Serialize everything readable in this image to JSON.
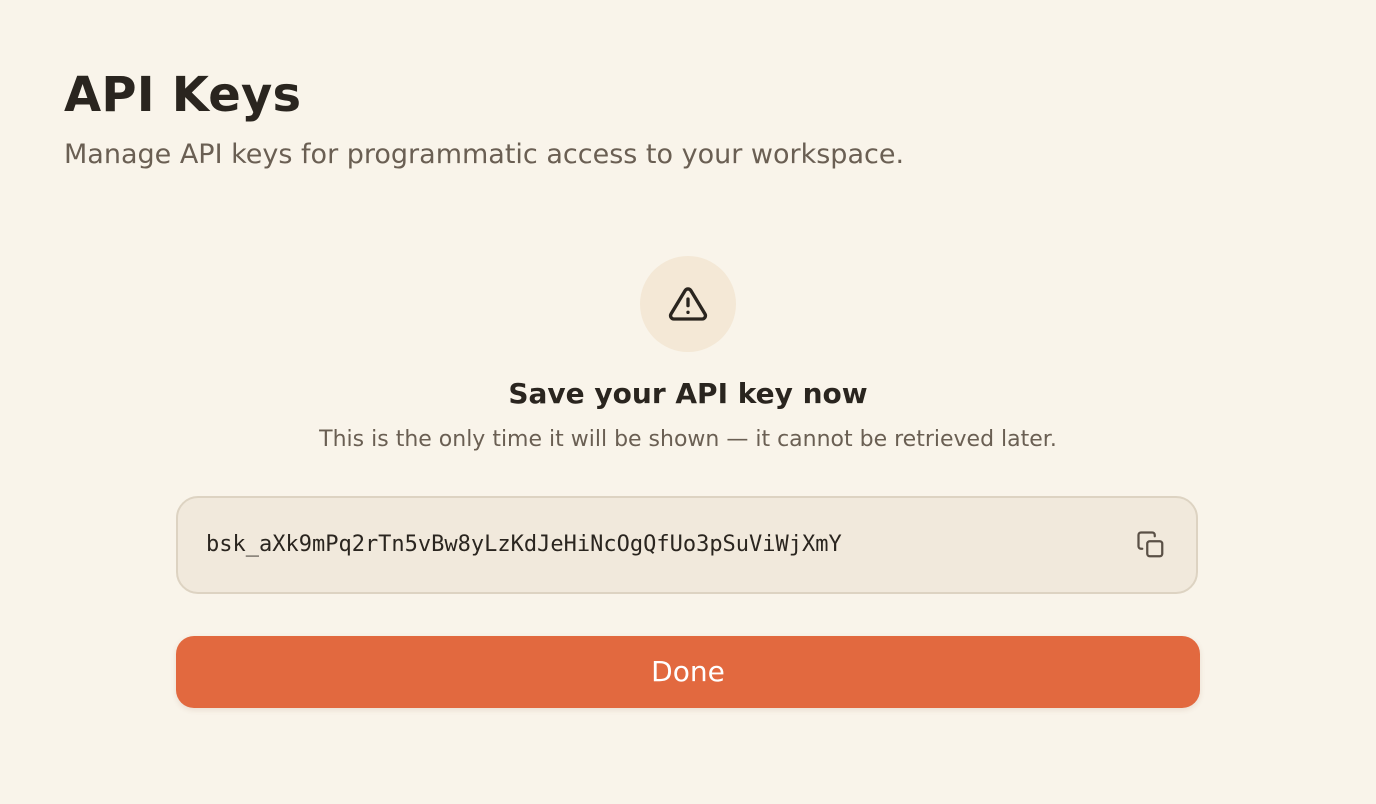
{
  "header": {
    "title": "API Keys",
    "subtitle": "Manage API keys for programmatic access to your workspace."
  },
  "notice": {
    "icon": "warning-triangle-icon",
    "title": "Save your API key now",
    "message": "This is the only time it will be shown — it cannot be retrieved later."
  },
  "key": {
    "value": "bsk_aXk9mPq2rTn5vBw8yLzKdJeHiNcOgQfUo3pSuViWjXmY",
    "copy_icon": "copy-icon"
  },
  "actions": {
    "done_label": "Done"
  },
  "colors": {
    "background": "#f9f4ea",
    "accent": "#e2693f",
    "text_primary": "#2a251f",
    "text_secondary": "#6a5f53",
    "key_box_bg": "#f1e9dc",
    "icon_circle_bg": "#f4e8d6"
  }
}
